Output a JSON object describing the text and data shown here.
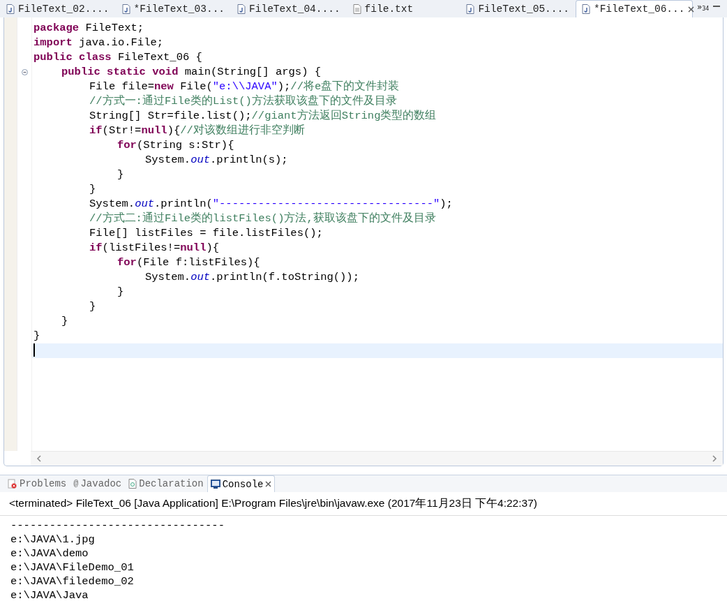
{
  "editor_tabs": [
    {
      "label": "FileText_02....",
      "kind": "java",
      "selected": false
    },
    {
      "label": "*FileText_03...",
      "kind": "java",
      "selected": false
    },
    {
      "label": "FileText_04....",
      "kind": "java",
      "selected": false
    },
    {
      "label": "file.txt",
      "kind": "text",
      "selected": false
    },
    {
      "label": "FileText_05....",
      "kind": "java",
      "selected": false
    },
    {
      "label": "*FileText_06...",
      "kind": "java",
      "selected": true
    }
  ],
  "overflow": {
    "glyph": "»",
    "count": "34"
  },
  "code": [
    {
      "tokens": [
        {
          "kind": "keyword",
          "text": "package"
        },
        {
          "kind": "plain",
          "text": " FileText;"
        }
      ]
    },
    {
      "tokens": [
        {
          "kind": "keyword",
          "text": "import"
        },
        {
          "kind": "plain",
          "text": " java.io.File;"
        }
      ]
    },
    {
      "tokens": [
        {
          "kind": "keyword",
          "text": "public class"
        },
        {
          "kind": "plain",
          "text": " FileText_06 {"
        }
      ],
      "children": [
        {
          "fold_marker": true,
          "tokens": [
            {
              "kind": "keyword",
              "text": "public static void"
            },
            {
              "kind": "plain",
              "text": " main(String[] args) {"
            }
          ],
          "children": [
            {
              "tokens": [
                {
                  "kind": "plain",
                  "text": "File file="
                },
                {
                  "kind": "keyword",
                  "text": "new"
                },
                {
                  "kind": "plain",
                  "text": " File("
                },
                {
                  "kind": "string",
                  "text": "\"e:\\\\JAVA\""
                },
                {
                  "kind": "plain",
                  "text": ");"
                },
                {
                  "kind": "comment",
                  "text": "//将e盘下的文件封装"
                }
              ]
            },
            {
              "tokens": [
                {
                  "kind": "comment",
                  "text": "//方式一:通过File类的List()方法获取该盘下的文件及目录"
                }
              ]
            },
            {
              "tokens": [
                {
                  "kind": "plain",
                  "text": "String[] Str=file.list();"
                },
                {
                  "kind": "comment",
                  "text": "//giant方法返回String类型的数组"
                }
              ]
            },
            {
              "tokens": [
                {
                  "kind": "keyword",
                  "text": "if"
                },
                {
                  "kind": "plain",
                  "text": "(Str!="
                },
                {
                  "kind": "keyword",
                  "text": "null"
                },
                {
                  "kind": "plain",
                  "text": "){"
                },
                {
                  "kind": "comment",
                  "text": "//对该数组进行非空判断"
                }
              ],
              "children": [
                {
                  "tokens": [
                    {
                      "kind": "keyword",
                      "text": "for"
                    },
                    {
                      "kind": "plain",
                      "text": "(String s:Str){"
                    }
                  ],
                  "children": [
                    {
                      "tokens": [
                        {
                          "kind": "plain",
                          "text": "System."
                        },
                        {
                          "kind": "field",
                          "text": "out"
                        },
                        {
                          "kind": "plain",
                          "text": ".println(s);"
                        }
                      ]
                    }
                  ]
                },
                {
                  "tokens": [
                    {
                      "kind": "plain",
                      "text": "}"
                    }
                  ]
                }
              ]
            },
            {
              "tokens": [
                {
                  "kind": "plain",
                  "text": "}"
                }
              ]
            },
            {
              "tokens": [
                {
                  "kind": "plain",
                  "text": "System."
                },
                {
                  "kind": "field",
                  "text": "out"
                },
                {
                  "kind": "plain",
                  "text": ".println("
                },
                {
                  "kind": "string",
                  "text": "\"---------------------------------\""
                },
                {
                  "kind": "plain",
                  "text": ");"
                }
              ]
            },
            {
              "tokens": [
                {
                  "kind": "comment",
                  "text": "//方式二:通过File类的listFiles()方法,获取该盘下的文件及目录"
                }
              ]
            },
            {
              "tokens": [
                {
                  "kind": "plain",
                  "text": "File[] listFiles = file.listFiles();"
                }
              ]
            },
            {
              "tokens": [
                {
                  "kind": "keyword",
                  "text": "if"
                },
                {
                  "kind": "plain",
                  "text": "(listFiles!="
                },
                {
                  "kind": "keyword",
                  "text": "null"
                },
                {
                  "kind": "plain",
                  "text": "){"
                }
              ],
              "children": [
                {
                  "tokens": [
                    {
                      "kind": "keyword",
                      "text": "for"
                    },
                    {
                      "kind": "plain",
                      "text": "(File f:listFiles){"
                    }
                  ],
                  "children": [
                    {
                      "tokens": [
                        {
                          "kind": "plain",
                          "text": "System."
                        },
                        {
                          "kind": "field",
                          "text": "out"
                        },
                        {
                          "kind": "plain",
                          "text": ".println(f.toString());"
                        }
                      ]
                    }
                  ]
                },
                {
                  "tokens": [
                    {
                      "kind": "plain",
                      "text": "}"
                    }
                  ]
                }
              ]
            },
            {
              "tokens": [
                {
                  "kind": "plain",
                  "text": "}"
                }
              ]
            }
          ]
        },
        {
          "tokens": [
            {
              "kind": "plain",
              "text": "}"
            }
          ]
        }
      ]
    },
    {
      "tokens": [
        {
          "kind": "plain",
          "text": "}"
        }
      ]
    },
    {
      "current": true
    }
  ],
  "panel_tabs": [
    {
      "label": "Problems",
      "kind": "problems",
      "selected": false
    },
    {
      "label": "Javadoc",
      "kind": "javadoc",
      "glyph": "@",
      "selected": false
    },
    {
      "label": "Declaration",
      "kind": "declaration",
      "selected": false
    },
    {
      "label": "Console",
      "kind": "console",
      "selected": true
    }
  ],
  "console": {
    "header": "<terminated> FileText_06 [Java Application] E:\\Program Files\\jre\\bin\\javaw.exe (2017年11月23日 下午4:22:37)",
    "output": [
      "---------------------------------",
      "e:\\JAVA\\1.jpg",
      "e:\\JAVA\\demo",
      "e:\\JAVA\\FileDemo_01",
      "e:\\JAVA\\filedemo_02",
      "e:\\JAVA\\Java"
    ]
  }
}
